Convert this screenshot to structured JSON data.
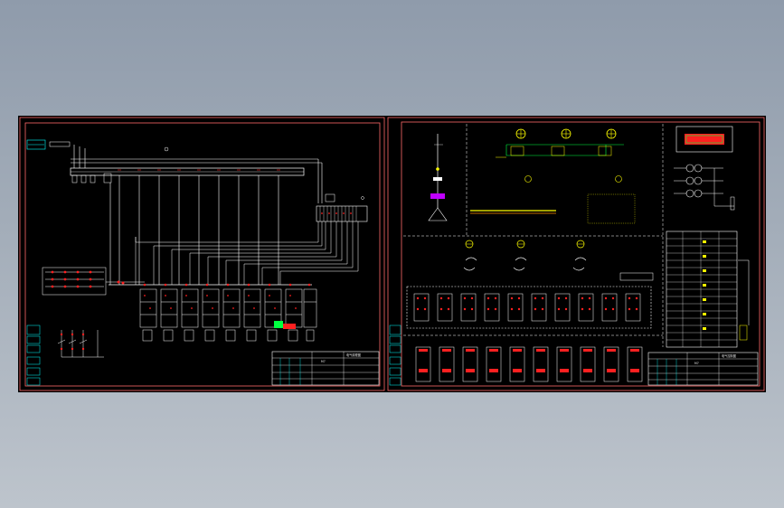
{
  "viewport": {
    "background": "#a3adb9"
  },
  "colors": {
    "sheet": "#000000",
    "border_red": "#ff6a6a",
    "border_white": "#ffffff",
    "wire_white": "#ffffff",
    "wire_yellow": "#ffff00",
    "wire_green": "#00ff40",
    "wire_cyan": "#00ffff",
    "accent_red": "#ff2020",
    "accent_magenta": "#c000ff"
  },
  "sheets": [
    {
      "name": "left-sheet",
      "title_block_texts": [
        "M7",
        "电气原理图"
      ]
    },
    {
      "name": "right-sheet",
      "title_block_texts": [
        "M7",
        "电气控制图"
      ]
    }
  ],
  "icons": [
    "motor-symbol-icon",
    "transformer-icon",
    "ammeter-icon",
    "relay-contact-icon"
  ]
}
